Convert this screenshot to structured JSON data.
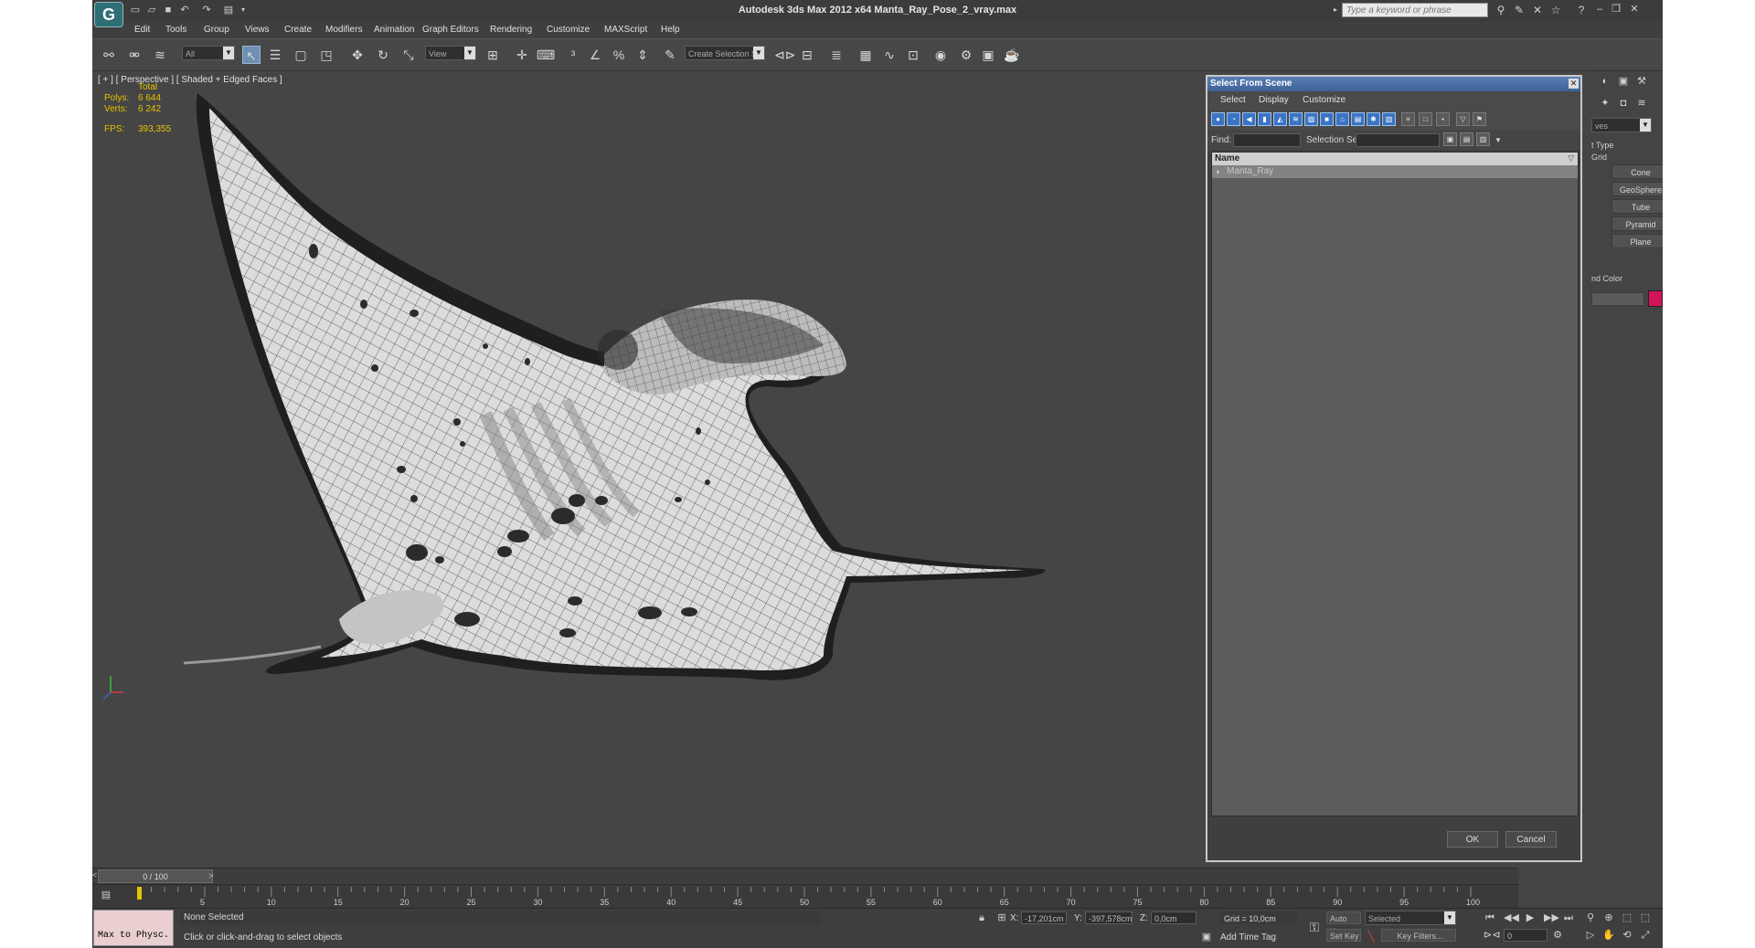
{
  "window": {
    "title": "Autodesk 3ds Max  2012 x64      Manta_Ray_Pose_2_vray.max",
    "search_placeholder": "Type a keyword or phrase"
  },
  "menu": [
    "Edit",
    "Tools",
    "Group",
    "Views",
    "Create",
    "Modifiers",
    "Animation",
    "Graph Editors",
    "Rendering",
    "Customize",
    "MAXScript",
    "Help"
  ],
  "toolbar": {
    "filter_value": "All",
    "view_value": "View",
    "selection_set_value": "Create Selection Se"
  },
  "viewport": {
    "label": "[ + ] [ Perspective ] [ Shaded + Edged Faces ]",
    "stats": {
      "total_label": "Total",
      "polys_label": "Polys:",
      "polys_value": "6 644",
      "verts_label": "Verts:",
      "verts_value": "6 242",
      "fps_label": "FPS:",
      "fps_value": "393,355"
    }
  },
  "command_panel": {
    "dropdown_value": "ves",
    "object_type_label": "t Type",
    "autogrid_label": "Grid",
    "buttons": [
      "Cone",
      "GeoSphere",
      "Tube",
      "Pyramid",
      "Plane"
    ],
    "name_color_label": "nd Color",
    "swatch_color": "#d4145a"
  },
  "dialog": {
    "title": "Select From Scene",
    "menu": [
      "Select",
      "Display",
      "Customize"
    ],
    "find_label": "Find:",
    "selection_set_label": "Selection Set:",
    "column_name": "Name",
    "objects": [
      "Manta_Ray"
    ],
    "ok": "OK",
    "cancel": "Cancel"
  },
  "timeline": {
    "frame_display": "0 / 100",
    "ticks": [
      "5",
      "10",
      "15",
      "20",
      "25",
      "30",
      "35",
      "40",
      "45",
      "50",
      "55",
      "60",
      "65",
      "70",
      "75",
      "80",
      "85",
      "90",
      "95",
      "100"
    ]
  },
  "status": {
    "maxscript": "Max to Physc.",
    "selection": "None Selected",
    "prompt": "Click or click-and-drag to select objects",
    "x_label": "X:",
    "x_value": "-17,201cm",
    "y_label": "Y:",
    "y_value": "-397,578cm",
    "z_label": "Z:",
    "z_value": "0,0cm",
    "grid": "Grid = 10,0cm",
    "add_time_tag": "Add Time Tag",
    "auto_key": "Auto Key",
    "auto_key_value": "Selected",
    "set_key": "Set Key",
    "key_filters": "Key Filters...",
    "frame_value": "0"
  }
}
